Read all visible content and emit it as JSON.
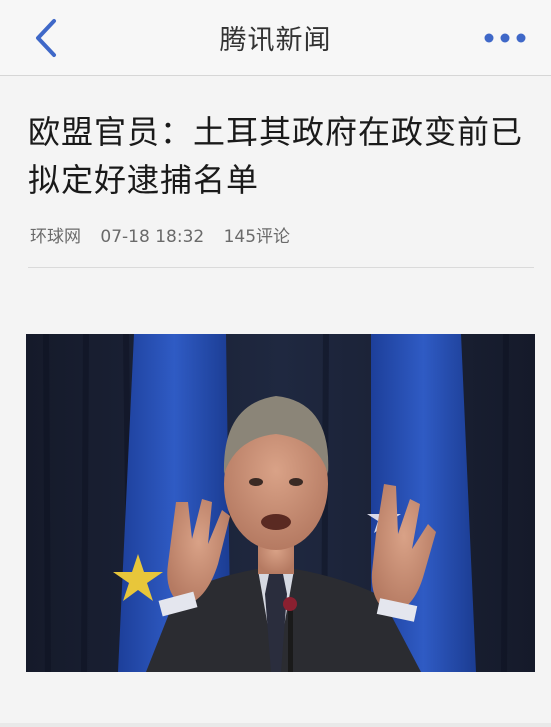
{
  "navbar": {
    "title": "腾讯新闻",
    "back_icon": "chevron-left-icon",
    "more_icon": "more-dots-icon",
    "accent_color": "#3f68c8"
  },
  "article": {
    "headline": "欧盟官员：土耳其政府在政变前已拟定好逮捕名单",
    "source": "环球网",
    "datetime": "07-18 18:32",
    "comments": "145评论"
  },
  "photo": {
    "subject": "photo-of-speaker-at-podium"
  }
}
